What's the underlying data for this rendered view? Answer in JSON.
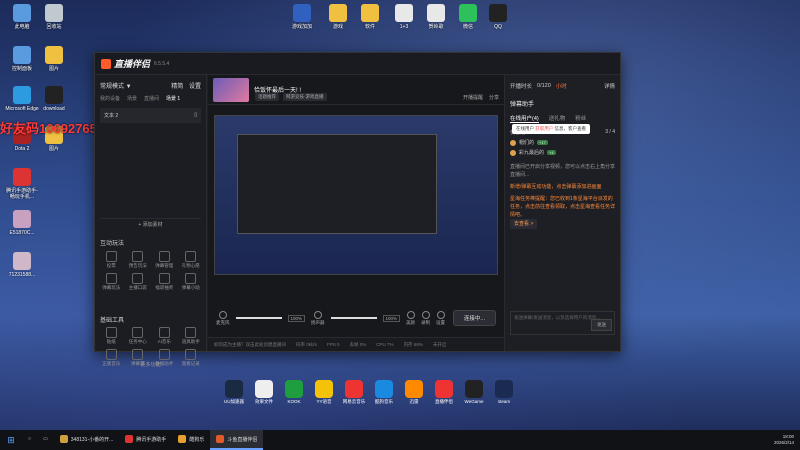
{
  "desktop_icons": [
    {
      "label": "此电脑",
      "color": "#5a9be0"
    },
    {
      "label": "回收站",
      "color": "#c0c8d0"
    },
    {
      "label": "控制面板",
      "color": "#5a9be0"
    },
    {
      "label": "图片",
      "color": "#f0c040"
    },
    {
      "label": "Microsoft Edge",
      "color": "#2d9be0"
    },
    {
      "label": "download",
      "color": "#222222"
    },
    {
      "label": "Dota 2",
      "color": "#aa2222"
    },
    {
      "label": "图片",
      "color": "#f0c040"
    },
    {
      "label": "腾讯手游助手-畅玩手机...",
      "color": "#dd3333"
    },
    {
      "label": "E51870C...",
      "color": "#c8a0c0"
    },
    {
      "label": "71231588...",
      "color": "#d0b8c8"
    }
  ],
  "top_icons": [
    {
      "label": "游戏加加",
      "color": "#3060c0"
    },
    {
      "label": "游戏",
      "color": "#f0c040"
    },
    {
      "label": "软件",
      "color": "#f0c040"
    },
    {
      "label": "1+3",
      "color": "#e8e8e8"
    },
    {
      "label": "贺岭歌",
      "color": "#e8e8e8"
    },
    {
      "label": "微信",
      "color": "#2ec05a"
    },
    {
      "label": "QQ",
      "color": "#222222"
    }
  ],
  "watermark": "好友码1069276527",
  "app": {
    "name": "直播伴侣",
    "version": "6.5.5.4",
    "left": {
      "mode": "常规模式 ▼",
      "actions": [
        "精简",
        "设置"
      ],
      "tabs": [
        "我的设备",
        "场景",
        "直播间",
        "场景 1"
      ],
      "scene_item": "文本 2",
      "add_label": "+ 添加素材",
      "interactive_title": "互动玩法",
      "interactive": [
        "投票",
        "预告玩法",
        "弹幕管理",
        "礼物心愿",
        "弹幕玩法",
        "主播口袋",
        "福袋抽奖",
        "弹幕小助"
      ],
      "tools_title": "基础工具",
      "tools": [
        "贴纸",
        "任务中心",
        "AI音乐",
        "道具助手",
        "正版音乐",
        "弹幕屏",
        "数据助手",
        "观看记录"
      ],
      "more": "更多功能"
    },
    "center": {
      "title": "恰饭怀最后一天! !",
      "chips": [
        "话题推荐",
        "网游竞技·游戏直播"
      ],
      "status": [
        "开播提醒",
        "分享"
      ],
      "status2": [
        "全屏看",
        "0",
        "0"
      ],
      "controls": {
        "mic_label": "麦克风",
        "mic_pct": "100%",
        "mic_fill": 1.0,
        "spk_label": "扬声器",
        "spk_pct": "100%",
        "spk_fill": 1.0,
        "items": [
          "美颜",
          "录制",
          "设置"
        ],
        "start": "连接中..."
      },
      "statusbar": [
        "如何成为主播？双击此处创建直播间",
        "码率 0kb/s",
        "FPS 0",
        "丢帧 0%",
        "CPU 7%",
        "内存 68%",
        "未开启"
      ]
    },
    "right": {
      "top": [
        "开播时长",
        "0/120",
        "小时",
        "详情"
      ],
      "panel_title": "弹幕助手",
      "tabs": [
        "在线用户(4)",
        "送礼物",
        "粉丝"
      ],
      "count": "3 / 4",
      "checkbox": "仅看观众",
      "audience": [
        {
          "name": "帽们的",
          "level": "+17"
        },
        {
          "name": "彩九最后的",
          "level": "+4"
        }
      ],
      "notices": [
        "直播间已开启分享视频，您可以点击右上角分享直播间...",
        "新增/弹幕互动功能，点击弹幕添加进画面",
        "星海任务棒提醒：您已收到1条星海平台派发的任务，点击前往查看领取，点击星海查看任务详情吧。"
      ],
      "go": "去查看 >",
      "input_placeholder": "发送弹幕/发送消息，以及选择用户的消息...",
      "send": "发送"
    },
    "toast": {
      "prefix": "在线用户",
      "highlight": "获取用户",
      "suffix": "信息，客户查看"
    }
  },
  "dock": [
    {
      "label": "UU加速器",
      "color": "#1a2a40"
    },
    {
      "label": "效果文件",
      "color": "#eeeeee"
    },
    {
      "label": "KOOK",
      "color": "#1e9e3e"
    },
    {
      "label": "YY语音",
      "color": "#f5c20a"
    },
    {
      "label": "网易云音乐",
      "color": "#e33"
    },
    {
      "label": "酷狗音乐",
      "color": "#1a8ae0"
    },
    {
      "label": "迅雷",
      "color": "#ff8a00"
    },
    {
      "label": "直播伴侣",
      "color": "#e33"
    },
    {
      "label": "WeGame",
      "color": "#222222"
    },
    {
      "label": "steam",
      "color": "#1a2a50"
    }
  ],
  "taskbar": {
    "items": [
      {
        "label": "348131-小番的开...",
        "color": "#d0a040",
        "active": false
      },
      {
        "label": "腾讯手游助手",
        "color": "#dd3333",
        "active": false
      },
      {
        "label": "酷狗乐",
        "color": "#e6a030",
        "active": false
      },
      {
        "label": "斗鱼直播伴侣",
        "color": "#e05a2a",
        "active": true
      }
    ],
    "time": "18:00",
    "date": "2026/2/14"
  }
}
